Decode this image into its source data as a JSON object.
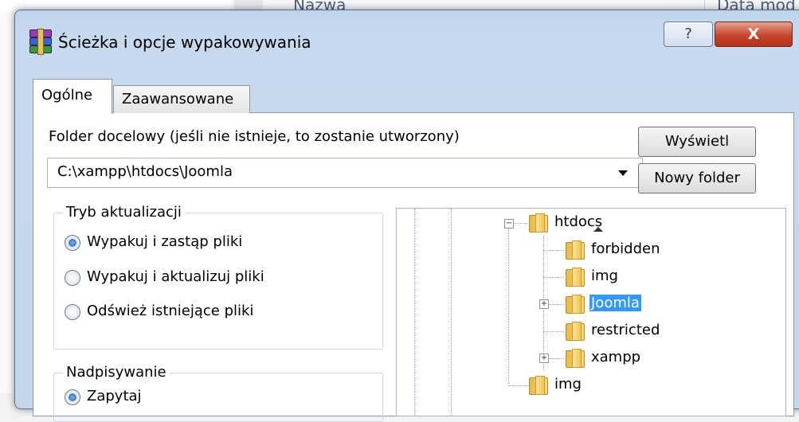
{
  "background": {
    "col_name": "Nazwa",
    "col_date": "Data mod"
  },
  "dialog": {
    "title": "Ścieżka i opcje wypakowywania",
    "help_label": "?",
    "close_label": "X"
  },
  "tabs": [
    {
      "label": "Ogólne"
    },
    {
      "label": "Zaawansowane"
    }
  ],
  "general": {
    "folder_label": "Folder docelowy (jeśli nie istnieje, to zostanie utworzony)",
    "path_value": "C:\\xampp\\htdocs\\Joomla",
    "show_button": "Wyświetl",
    "new_folder_button": "Nowy folder",
    "update_mode": {
      "title": "Tryb aktualizacji",
      "options": [
        {
          "label": "Wypakuj i zastąp pliki",
          "selected": true
        },
        {
          "label": "Wypakuj i aktualizuj pliki",
          "selected": false
        },
        {
          "label": "Odśwież istniejące pliki",
          "selected": false
        }
      ]
    },
    "overwrite": {
      "title": "Nadpisywanie",
      "first_option": "Zapytaj"
    }
  },
  "tree": {
    "nodes": [
      {
        "label": "htdocs"
      },
      {
        "label": "forbidden"
      },
      {
        "label": "img"
      },
      {
        "label": "Joomla",
        "selected": true
      },
      {
        "label": "restricted"
      },
      {
        "label": "xampp"
      },
      {
        "label": "img"
      }
    ]
  },
  "colors": {
    "selection": "#3399ff",
    "close_button": "#c7452d",
    "titlebar": "#bed3ea"
  }
}
